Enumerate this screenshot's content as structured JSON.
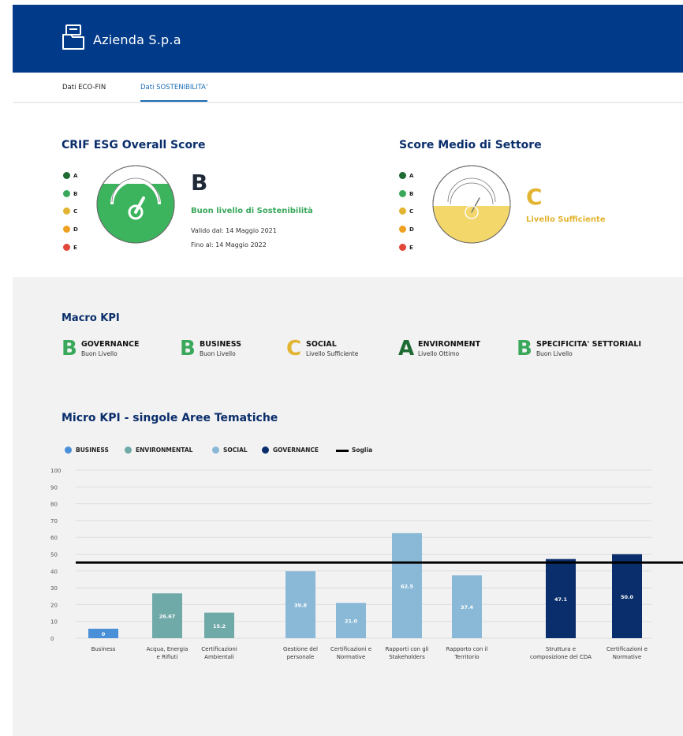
{
  "app": {
    "title": "Azienda S.p.a",
    "logo_icon": "folder-icon"
  },
  "tabs": [
    {
      "label": "Dati ECO-FIN",
      "active": false
    },
    {
      "label": "Dati SOSTENIBILITA'",
      "active": true
    }
  ],
  "grade_legend": [
    {
      "letter": "A",
      "color": "#1e6b34"
    },
    {
      "letter": "B",
      "color": "#3aa85b"
    },
    {
      "letter": "C",
      "color": "#e2b431"
    },
    {
      "letter": "D",
      "color": "#f0a020"
    },
    {
      "letter": "E",
      "color": "#e2473a"
    }
  ],
  "overall": {
    "title": "CRIF ESG Overall Score",
    "grade": "B",
    "grade_color": "#3aa85b",
    "description": "Buon livello di Sostenibilità",
    "valid_from": "Valido dal: 14 Maggio 2021",
    "valid_to": "Fino al: 14 Maggio 2022",
    "gauge_fill_color": "#3cb45e",
    "gauge_icon": "gauge-icon"
  },
  "sector": {
    "title": "Score Medio di Settore",
    "grade": "C",
    "grade_color": "#e2b431",
    "description": "Livello Sufficiente",
    "gauge_fill_color": "#f4d76a",
    "gauge_icon": "gauge-icon"
  },
  "macro": {
    "title": "Macro KPI",
    "items": [
      {
        "grade": "B",
        "name": "GOVERNANCE",
        "level": "Buon Livello",
        "color": "#3aa85b"
      },
      {
        "grade": "B",
        "name": "BUSINESS",
        "level": "Buon Livello",
        "color": "#3aa85b"
      },
      {
        "grade": "C",
        "name": "SOCIAL",
        "level": "Livello Sufficiente",
        "color": "#e2b431"
      },
      {
        "grade": "A",
        "name": "ENVIRONMENT",
        "level": "Livello Ottimo",
        "color": "#1e6b34"
      },
      {
        "grade": "B",
        "name": "SPECIFICITA' SETTORIALI",
        "level": "Buon Livello",
        "color": "#3aa85b"
      }
    ]
  },
  "micro": {
    "title": "Micro KPI - singole Aree Tematiche",
    "legend": [
      {
        "label": "BUSINESS",
        "color": "#4a90d9",
        "kind": "dot"
      },
      {
        "label": "ENVIRONMENTAL",
        "color": "#6fa9a8",
        "kind": "dot"
      },
      {
        "label": "SOCIAL",
        "color": "#8ab9d8",
        "kind": "dot"
      },
      {
        "label": "GOVERNANCE",
        "color": "#0a2e6b",
        "kind": "dot"
      },
      {
        "label": "Soglia",
        "color": "#000000",
        "kind": "line"
      }
    ]
  },
  "chart_data": {
    "type": "bar",
    "ylim": [
      0,
      100
    ],
    "y_ticks": [
      "0",
      "10",
      "20",
      "30",
      "40",
      "50",
      "60",
      "70",
      "80",
      "90",
      "100"
    ],
    "threshold": 45,
    "bars": [
      {
        "category": [
          "Business"
        ],
        "value": 0,
        "value_label": "0",
        "series": "BUSINESS",
        "color": "#4a90d9"
      },
      {
        "category": [
          "Acqua, Energia",
          "e Rifiuti"
        ],
        "value": 26.67,
        "value_label": "26.67",
        "series": "ENVIRONMENTAL",
        "color": "#6fa9a8"
      },
      {
        "category": [
          "Certificazioni",
          "Ambientali"
        ],
        "value": 15.2,
        "value_label": "15.2",
        "series": "ENVIRONMENTAL",
        "color": "#6fa9a8"
      },
      {
        "category": [
          "Gestione del",
          "personale"
        ],
        "value": 39.8,
        "value_label": "39.8",
        "series": "SOCIAL",
        "color": "#8ab9d8"
      },
      {
        "category": [
          "Certificazioni e",
          "Normative"
        ],
        "value": 21.0,
        "value_label": "21.0",
        "series": "SOCIAL",
        "color": "#8ab9d8"
      },
      {
        "category": [
          "Rapporti con gli",
          "Stakeholders"
        ],
        "value": 62.5,
        "value_label": "62.5",
        "series": "SOCIAL",
        "color": "#8ab9d8"
      },
      {
        "category": [
          "Rapporto con il",
          "Territorio"
        ],
        "value": 37.4,
        "value_label": "37.4",
        "series": "SOCIAL",
        "color": "#8ab9d8"
      },
      {
        "category": [
          "Struttura e",
          "composizione del CDA"
        ],
        "value": 47.1,
        "value_label": "47.1",
        "series": "GOVERNANCE",
        "color": "#0a2e6b"
      },
      {
        "category": [
          "Certificazioni e",
          "Normative"
        ],
        "value": 50.0,
        "value_label": "50.0",
        "series": "GOVERNANCE",
        "color": "#0a2e6b"
      }
    ]
  }
}
